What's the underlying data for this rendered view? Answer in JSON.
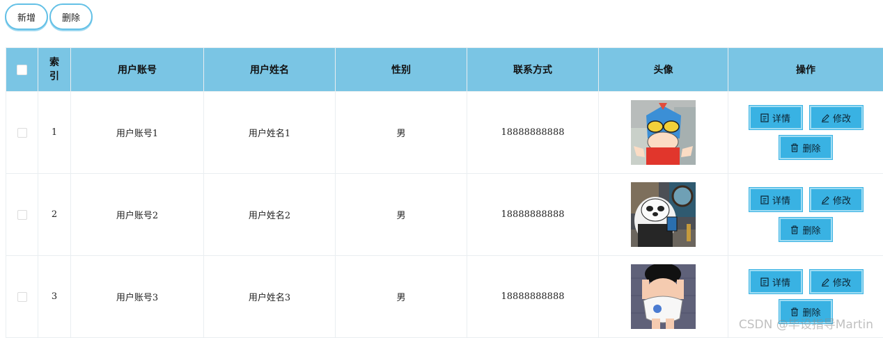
{
  "toolbar": {
    "add_label": "新增",
    "delete_label": "删除"
  },
  "table": {
    "headers": {
      "index": "索引",
      "account": "用户账号",
      "name": "用户姓名",
      "gender": "性别",
      "phone": "联系方式",
      "avatar": "头像",
      "actions": "操作"
    },
    "rows": [
      {
        "index": "1",
        "account": "用户账号1",
        "name": "用户姓名1",
        "gender": "男",
        "phone": "18888888888"
      },
      {
        "index": "2",
        "account": "用户账号2",
        "name": "用户姓名2",
        "gender": "男",
        "phone": "18888888888"
      },
      {
        "index": "3",
        "account": "用户账号3",
        "name": "用户姓名3",
        "gender": "男",
        "phone": "18888888888"
      }
    ],
    "action_labels": {
      "details": "详情",
      "edit": "修改",
      "delete": "删除"
    }
  },
  "watermark": "CSDN @毕设指导Martin",
  "colors": {
    "header_bg": "#7ac5e4",
    "action_button_bg": "#39b2e3",
    "pill_border": "#63c0e6"
  },
  "icons": [
    "document-icon",
    "pencil-icon",
    "trash-icon"
  ]
}
